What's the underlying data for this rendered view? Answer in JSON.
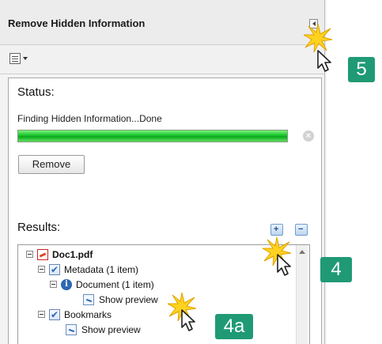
{
  "panel": {
    "title": "Remove Hidden Information"
  },
  "status": {
    "heading": "Status:",
    "message": "Finding Hidden Information...Done",
    "progress_percent": 100,
    "remove_label": "Remove"
  },
  "results": {
    "heading": "Results:",
    "tree": [
      {
        "label": "Doc1.pdf",
        "icon": "pdf-icon",
        "bold": true
      },
      {
        "label": "Metadata (1 item)",
        "icon": "checkbox-checked-icon"
      },
      {
        "label": "Document (1 item)",
        "icon": "info-icon"
      },
      {
        "label": "Show preview",
        "icon": "preview-icon"
      },
      {
        "label": "Bookmarks",
        "icon": "checkbox-checked-icon"
      },
      {
        "label": "Show preview",
        "icon": "preview-icon"
      }
    ]
  },
  "callouts": {
    "c5": "5",
    "c4": "4",
    "c4a": "4a"
  },
  "colors": {
    "callout": "#1f9a74",
    "progress": "#17c42b",
    "highlight": "#ffd21f"
  }
}
